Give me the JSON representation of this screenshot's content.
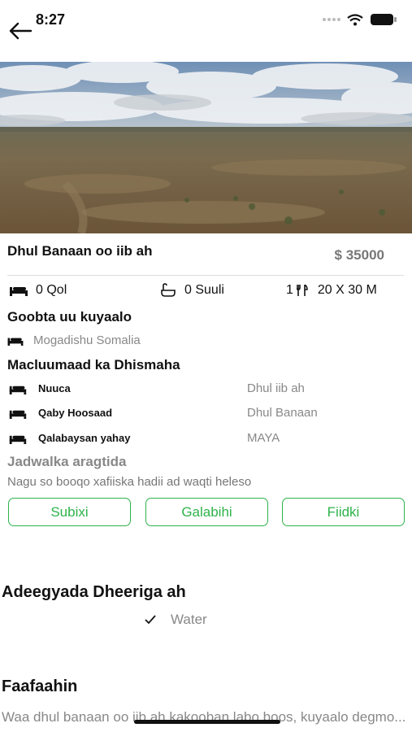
{
  "status_bar": {
    "time": "8:27"
  },
  "listing": {
    "title": "Dhul Banaan oo iib ah",
    "price": "$ 35000"
  },
  "stats": {
    "rooms": "0 Qol",
    "toilets": "0 Suuli",
    "size_prefix": "1",
    "size": "20 X 30 M"
  },
  "location": {
    "heading": "Goobta uu kuyaalo",
    "value": "Mogadishu Somalia"
  },
  "details": {
    "heading": "Macluumaad ka Dhismaha",
    "rows": [
      {
        "label": "Nuuca",
        "value": "Dhul iib ah"
      },
      {
        "label": "Qaby Hoosaad",
        "value": "Dhul Banaan"
      },
      {
        "label": "Qalabaysan yahay",
        "value": "MAYA"
      }
    ]
  },
  "schedule": {
    "heading": "Jadwalka aragtida",
    "note": "Nagu so booqo xafiiska hadii ad waqti heleso",
    "buttons": [
      "Subixi",
      "Galabihi",
      "Fiidki"
    ]
  },
  "amenities": {
    "heading": "Adeegyada Dheeriga ah",
    "items": [
      "Water"
    ]
  },
  "description": {
    "heading": "Faafaahin",
    "text": "Waa dhul banaan oo iib ah kakooban labo boos, kuyaalo degmo..."
  },
  "colors": {
    "accent": "#2eb34b",
    "muted": "#888888"
  }
}
